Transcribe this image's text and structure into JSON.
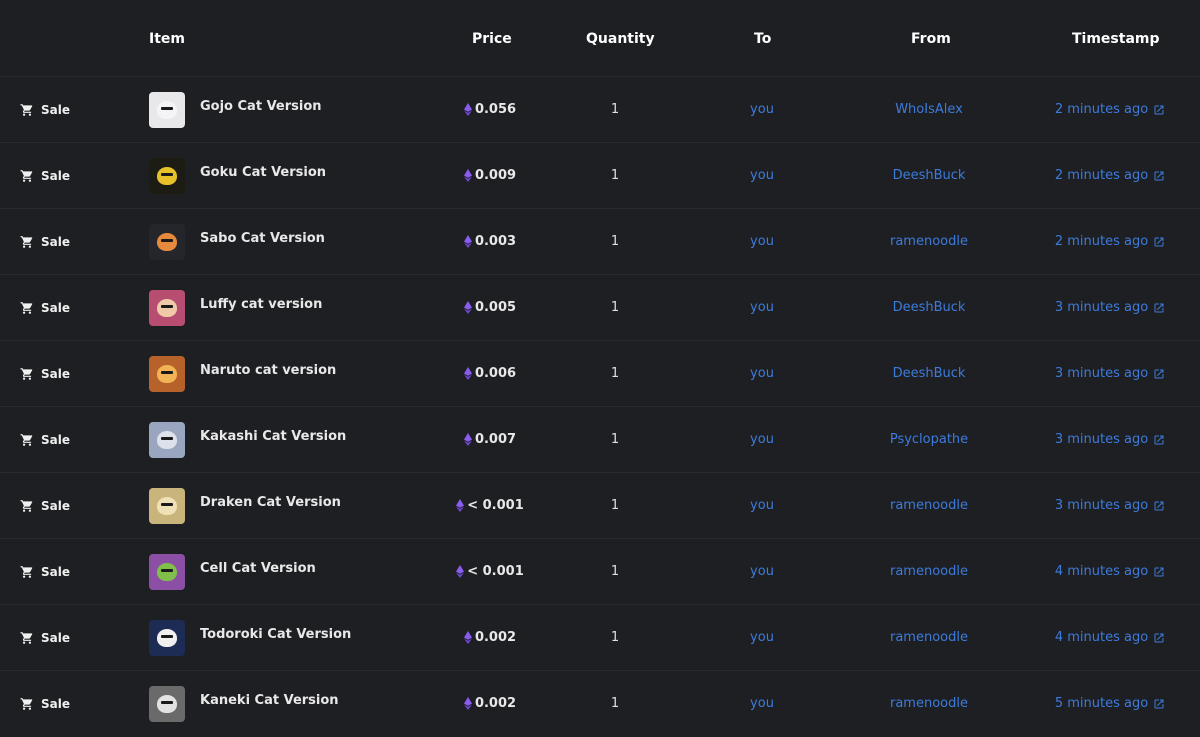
{
  "header": {
    "item": "Item",
    "price": "Price",
    "quantity": "Quantity",
    "to": "To",
    "from": "From",
    "timestamp": "Timestamp"
  },
  "rows": [
    {
      "event": "Sale",
      "item": "Gojo Cat Version",
      "price": "0.056",
      "quantity": "1",
      "to": "you",
      "from": "WhoIsAlex",
      "timestamp": "2 minutes ago",
      "thumb_bg": "#e8e8ea",
      "thumb_face": "#f4f4f6"
    },
    {
      "event": "Sale",
      "item": "Goku Cat Version",
      "price": "0.009",
      "quantity": "1",
      "to": "you",
      "from": "DeeshBuck",
      "timestamp": "2 minutes ago",
      "thumb_bg": "#1c1c14",
      "thumb_face": "#e6c12a"
    },
    {
      "event": "Sale",
      "item": "Sabo Cat Version",
      "price": "0.003",
      "quantity": "1",
      "to": "you",
      "from": "ramenoodle",
      "timestamp": "2 minutes ago",
      "thumb_bg": "#24262b",
      "thumb_face": "#e58a3c"
    },
    {
      "event": "Sale",
      "item": "Luffy cat version",
      "price": "0.005",
      "quantity": "1",
      "to": "you",
      "from": "DeeshBuck",
      "timestamp": "3 minutes ago",
      "thumb_bg": "#b84d72",
      "thumb_face": "#f0c9a8"
    },
    {
      "event": "Sale",
      "item": "Naruto cat version",
      "price": "0.006",
      "quantity": "1",
      "to": "you",
      "from": "DeeshBuck",
      "timestamp": "3 minutes ago",
      "thumb_bg": "#b8622b",
      "thumb_face": "#f1b356"
    },
    {
      "event": "Sale",
      "item": "Kakashi Cat Version",
      "price": "0.007",
      "quantity": "1",
      "to": "you",
      "from": "Psyclopathe",
      "timestamp": "3 minutes ago",
      "thumb_bg": "#9aa6c0",
      "thumb_face": "#dde1ea"
    },
    {
      "event": "Sale",
      "item": "Draken Cat Version",
      "price": "< 0.001",
      "quantity": "1",
      "to": "you",
      "from": "ramenoodle",
      "timestamp": "3 minutes ago",
      "thumb_bg": "#c9b47c",
      "thumb_face": "#efe0b5"
    },
    {
      "event": "Sale",
      "item": "Cell Cat Version",
      "price": "< 0.001",
      "quantity": "1",
      "to": "you",
      "from": "ramenoodle",
      "timestamp": "4 minutes ago",
      "thumb_bg": "#8c4fa6",
      "thumb_face": "#7fbf4a"
    },
    {
      "event": "Sale",
      "item": "Todoroki Cat Version",
      "price": "0.002",
      "quantity": "1",
      "to": "you",
      "from": "ramenoodle",
      "timestamp": "4 minutes ago",
      "thumb_bg": "#1d2c55",
      "thumb_face": "#f0f0f0"
    },
    {
      "event": "Sale",
      "item": "Kaneki Cat Version",
      "price": "0.002",
      "quantity": "1",
      "to": "you",
      "from": "ramenoodle",
      "timestamp": "5 minutes ago",
      "thumb_bg": "#6a6a6a",
      "thumb_face": "#e2e2e2"
    }
  ],
  "colors": {
    "background": "#1e1f22",
    "link": "#3d7bdc",
    "eth": "#8a5cf0",
    "divider": "#2a2b2f"
  },
  "icons": {
    "event": "cart-icon",
    "price": "ethereum-icon",
    "timestamp": "external-link-icon"
  }
}
